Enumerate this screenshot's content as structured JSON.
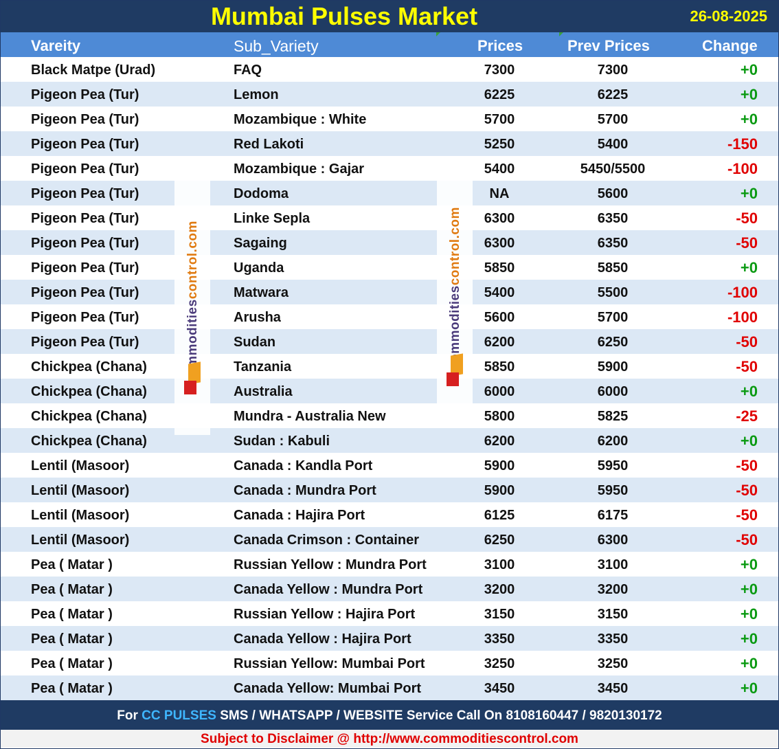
{
  "header": {
    "title": "Mumbai Pulses Market",
    "date": "26-08-2025"
  },
  "columns": {
    "variety": "Vareity",
    "sub_variety": "Sub_Variety",
    "prices": "Prices",
    "prev_prices": "Prev Prices",
    "change": "Change"
  },
  "rows": [
    {
      "variety": "Black Matpe (Urad)",
      "sub_variety": "FAQ",
      "price": "7300",
      "prev": "7300",
      "change": "+0",
      "dir": "up"
    },
    {
      "variety": "Pigeon Pea (Tur)",
      "sub_variety": "Lemon",
      "price": "6225",
      "prev": "6225",
      "change": "+0",
      "dir": "up"
    },
    {
      "variety": "Pigeon Pea (Tur)",
      "sub_variety": "Mozambique : White",
      "price": "5700",
      "prev": "5700",
      "change": "+0",
      "dir": "up"
    },
    {
      "variety": "Pigeon Pea (Tur)",
      "sub_variety": "Red Lakoti",
      "price": "5250",
      "prev": "5400",
      "change": "-150",
      "dir": "down"
    },
    {
      "variety": "Pigeon Pea (Tur)",
      "sub_variety": "Mozambique : Gajar",
      "price": "5400",
      "prev": "5450/5500",
      "change": "-100",
      "dir": "down"
    },
    {
      "variety": "Pigeon Pea (Tur)",
      "sub_variety": "Dodoma",
      "price": "NA",
      "prev": "5600",
      "change": "+0",
      "dir": "up"
    },
    {
      "variety": "Pigeon Pea (Tur)",
      "sub_variety": "Linke Sepla",
      "price": "6300",
      "prev": "6350",
      "change": "-50",
      "dir": "down"
    },
    {
      "variety": "Pigeon Pea (Tur)",
      "sub_variety": "Sagaing",
      "price": "6300",
      "prev": "6350",
      "change": "-50",
      "dir": "down"
    },
    {
      "variety": "Pigeon Pea (Tur)",
      "sub_variety": "Uganda",
      "price": "5850",
      "prev": "5850",
      "change": "+0",
      "dir": "up"
    },
    {
      "variety": "Pigeon Pea (Tur)",
      "sub_variety": "Matwara",
      "price": "5400",
      "prev": "5500",
      "change": "-100",
      "dir": "down"
    },
    {
      "variety": "Pigeon Pea (Tur)",
      "sub_variety": "Arusha",
      "price": "5600",
      "prev": "5700",
      "change": "-100",
      "dir": "down"
    },
    {
      "variety": "Pigeon Pea (Tur)",
      "sub_variety": "Sudan",
      "price": "6200",
      "prev": "6250",
      "change": "-50",
      "dir": "down"
    },
    {
      "variety": "Chickpea (Chana)",
      "sub_variety": "Tanzania",
      "price": "5850",
      "prev": "5900",
      "change": "-50",
      "dir": "down"
    },
    {
      "variety": "Chickpea (Chana)",
      "sub_variety": "Australia",
      "price": "6000",
      "prev": "6000",
      "change": "+0",
      "dir": "up"
    },
    {
      "variety": "Chickpea (Chana)",
      "sub_variety": "Mundra - Australia New",
      "price": "5800",
      "prev": "5825",
      "change": "-25",
      "dir": "down"
    },
    {
      "variety": "Chickpea (Chana)",
      "sub_variety": "Sudan : Kabuli",
      "price": "6200",
      "prev": "6200",
      "change": "+0",
      "dir": "up"
    },
    {
      "variety": "Lentil (Masoor)",
      "sub_variety": "Canada : Kandla Port",
      "price": "5900",
      "prev": "5950",
      "change": "-50",
      "dir": "down"
    },
    {
      "variety": "Lentil (Masoor)",
      "sub_variety": "Canada : Mundra Port",
      "price": "5900",
      "prev": "5950",
      "change": "-50",
      "dir": "down"
    },
    {
      "variety": "Lentil (Masoor)",
      "sub_variety": "Canada : Hajira Port",
      "price": "6125",
      "prev": "6175",
      "change": "-50",
      "dir": "down"
    },
    {
      "variety": "Lentil (Masoor)",
      "sub_variety": "Canada Crimson : Container",
      "price": "6250",
      "prev": "6300",
      "change": "-50",
      "dir": "down"
    },
    {
      "variety": "Pea ( Matar )",
      "sub_variety": "Russian Yellow : Mundra Port",
      "price": "3100",
      "prev": "3100",
      "change": "+0",
      "dir": "up"
    },
    {
      "variety": "Pea ( Matar )",
      "sub_variety": "Canada Yellow : Mundra Port",
      "price": "3200",
      "prev": "3200",
      "change": "+0",
      "dir": "up"
    },
    {
      "variety": "Pea ( Matar )",
      "sub_variety": "Russian Yellow : Hajira Port",
      "price": "3150",
      "prev": "3150",
      "change": "+0",
      "dir": "up"
    },
    {
      "variety": "Pea ( Matar )",
      "sub_variety": "Canada Yellow : Hajira Port",
      "price": "3350",
      "prev": "3350",
      "change": "+0",
      "dir": "up"
    },
    {
      "variety": "Pea ( Matar )",
      "sub_variety": "Russian Yellow: Mumbai Port",
      "price": "3250",
      "prev": "3250",
      "change": "+0",
      "dir": "up"
    },
    {
      "variety": "Pea ( Matar )",
      "sub_variety": "Canada Yellow: Mumbai Port",
      "price": "3450",
      "prev": "3450",
      "change": "+0",
      "dir": "up"
    }
  ],
  "watermark": {
    "text_main": "commodities",
    "text_accent": "control.com"
  },
  "footer": {
    "prefix": "For ",
    "brand": "CC PULSES",
    "suffix": " SMS / WHATSAPP / WEBSITE Service Call On 8108160447 / 9820130172",
    "disclaimer": "Subject to Disclaimer @  http://www.commoditiescontrol.com"
  },
  "colors": {
    "title_bg": "#1f3b63",
    "title_text": "#ffff00",
    "header_bg": "#4e8ad6",
    "alt_row_bg": "#dce8f5",
    "positive": "#0a9a12",
    "negative": "#e00000",
    "footer_brand": "#3fb6ff",
    "disclaimer_text": "#e00000"
  }
}
